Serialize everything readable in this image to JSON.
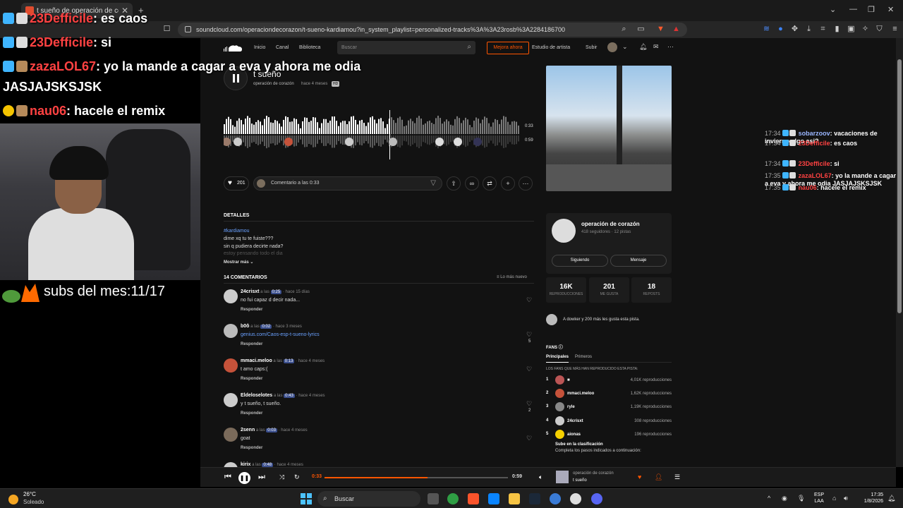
{
  "browser": {
    "tab_title": "t sueño de operación de coraz",
    "new_tab": "+",
    "url": "soundcloud.com/operaciondecorazon/t-sueno-kardiamou?in_system_playlist=personalized-tracks%3A%3A23rosb%3A2284186700",
    "window_controls": [
      "⌄",
      "—",
      "❐",
      "✕"
    ]
  },
  "overlay_chat": [
    {
      "user": "23Defficile",
      "message": ": es caos"
    },
    {
      "user": "23Defficile",
      "message": ": si"
    },
    {
      "user": "zazaLOL67",
      "message": ": yo la mande a cagar a eva y ahora me odia",
      "message_cont": "JASJAJSKSJSK"
    },
    {
      "user": "nau06",
      "message": ": hacele el remix"
    }
  ],
  "subs": "subs del mes:11/17",
  "soundcloud": {
    "nav": {
      "home": "Inicio",
      "feed": "Canal",
      "library": "Biblioteca",
      "search_placeholder": "Buscar",
      "upgrade": "Mejora ahora",
      "for_artists": "Estudio de artista",
      "upload": "Subir"
    },
    "track": {
      "title": "t sueño",
      "artist": "operación de corazón",
      "ago": "hace 4 meses",
      "quality": "HD",
      "current_time": "0:33",
      "duration": "0:59",
      "progress_fraction": 0.56
    },
    "actions": {
      "likes": "201",
      "comment_placeholder": "Comentario a las 0:33"
    },
    "details": {
      "heading": "DETALLES",
      "tag": "#kardiamou",
      "lines": [
        "dime xq tu te fuiste???",
        "sin q pudiera decirte nada?",
        "estoy pensando todo el dia"
      ],
      "show_more": "Mostrar más"
    },
    "comments": {
      "heading": "14 COMENTARIOS",
      "sort": "Lo más nuevo",
      "reply": "Responder",
      "items": [
        {
          "user": "24crisxt",
          "at": "a las",
          "ts": "0:25",
          "ago": "hace 15 días",
          "text": "no fui capaz d decir nada...",
          "count": ""
        },
        {
          "user": "b0ô",
          "at": "a las",
          "ts": "0:02",
          "ago": "hace 3 meses",
          "text": "genius.com/Caos-esp-t-sueno-lyrics",
          "count": "5"
        },
        {
          "user": "mmaci.meloo",
          "at": "a las",
          "ts": "0:13",
          "ago": "hace 4 meses",
          "text": "t amo caps:(",
          "count": ""
        },
        {
          "user": "Eldeloselotes",
          "at": "a las",
          "ts": "0:43",
          "ago": "hace 4 meses",
          "text": "y t sueño, t sueño.",
          "count": "2"
        },
        {
          "user": "2senn",
          "at": "a las",
          "ts": "0:03",
          "ago": "hace 4 meses",
          "text": "goat",
          "count": ""
        },
        {
          "user": "kirix",
          "at": "a las",
          "ts": "0:48",
          "ago": "hace 4 meses",
          "text": "",
          "count": ""
        }
      ]
    },
    "artist_card": {
      "name": "operación de corazón",
      "stats": "418 seguidores · 12 pistas",
      "following": "Siguiendo",
      "message": "Mensaje"
    },
    "stats": [
      {
        "value": "16K",
        "label": "REPRODUCCIONES"
      },
      {
        "value": "201",
        "label": "ME GUSTA"
      },
      {
        "value": "18",
        "label": "REPOSTS"
      }
    ],
    "likers": "A dowker y 200 más les gusta esta pista.",
    "fans": {
      "heading": "FANS",
      "tabs": [
        "Principales",
        "Primeros"
      ],
      "sub": "LOS FANS QUE MÁS HAN REPRODUCIDO ESTA PISTA:",
      "items": [
        {
          "rank": "1",
          "name": "■",
          "plays": "4,01K reproducciones"
        },
        {
          "rank": "2",
          "name": "mmaci.meloo",
          "plays": "1,62K reproducciones"
        },
        {
          "rank": "3",
          "name": "ryle",
          "plays": "1,19K reproducciones"
        },
        {
          "rank": "4",
          "name": "24crisxt",
          "plays": "308 reproducciones"
        },
        {
          "rank": "5",
          "name": "aionas",
          "plays": "196 reproducciones"
        }
      ],
      "climb_title": "Sube en la clasificación",
      "climb_sub": "Completa los pasos indicados a continuación:"
    },
    "player": {
      "current": "0:33",
      "duration": "0:59",
      "artist": "operación de corazón",
      "title": "t sueño"
    }
  },
  "right_chat": [
    {
      "time": "17:34",
      "user": "sobarzoov",
      "message": ": vacaciones de invierno algo asi?",
      "color": "blue"
    },
    {
      "time": "17:34",
      "user": "23Defficile",
      "message": ": es caos",
      "color": "red"
    },
    {
      "time": "17:34",
      "user": "23Defficile",
      "message": ": si",
      "color": "red"
    },
    {
      "time": "17:35",
      "user": "zazaLOL67",
      "message": ": yo la mande a cagar a eva y ahora me odia JASJAJSKSJSK",
      "color": "red"
    },
    {
      "time": "17:35",
      "user": "nau06",
      "message": ": hacele el remix",
      "color": "red"
    }
  ],
  "taskbar": {
    "temp": "26°C",
    "weather": "Soleado",
    "search": "Buscar",
    "lang1": "ESP",
    "lang2": "LAA",
    "time": "17:35",
    "date": "1/8/2026"
  },
  "colors": {
    "accent": "#ff5500",
    "chat_user": "#ff4242",
    "link": "#6aa1ff"
  }
}
